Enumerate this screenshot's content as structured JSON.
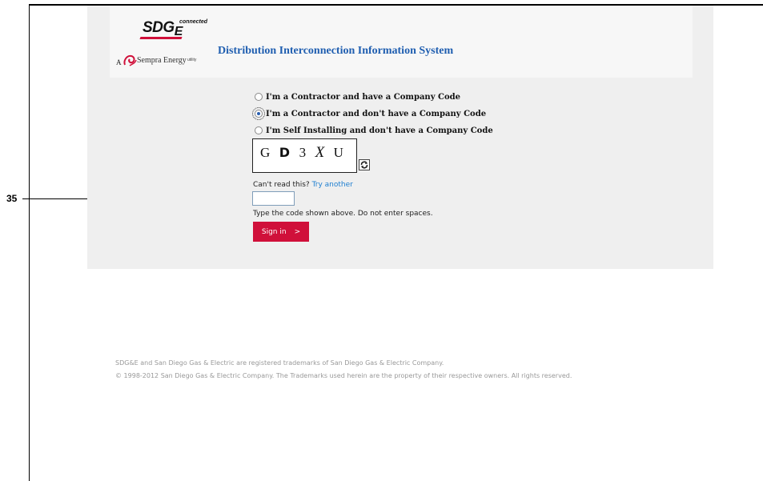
{
  "annotation": {
    "callout_number": "35"
  },
  "header": {
    "logo": {
      "brand": "SDG",
      "brand_e": "E",
      "tagline": "connected",
      "parent_prefix": "A",
      "parent_name": "Sempra Energy",
      "parent_suffix": "utility"
    },
    "title": "Distribution Interconnection Information System"
  },
  "form": {
    "options": [
      {
        "label": "I'm a Contractor and have a Company Code",
        "checked": false
      },
      {
        "label": "I'm a Contractor and don't have a Company Code",
        "checked": true
      },
      {
        "label": "I'm Self Installing and don't have a Company Code",
        "checked": false
      }
    ],
    "captcha": {
      "chars": [
        "G",
        "D",
        "3",
        "X",
        "U"
      ]
    },
    "refresh_icon": "refresh-icon",
    "cant_read": "Can't read this?",
    "try_another": "Try another",
    "code_input": {
      "value": "",
      "placeholder": ""
    },
    "hint": "Type the code shown above. Do not enter spaces.",
    "signin_label": "Sign in",
    "signin_arrow": ">"
  },
  "footer": {
    "line1": "SDG&E and San Diego Gas & Electric are registered trademarks of San Diego Gas & Electric Company.",
    "line2": "© 1998-2012 San Diego Gas & Electric Company. The Trademarks used herein are the property of their respective owners. All rights reserved."
  },
  "colors": {
    "accent": "#d0103a",
    "link": "#1f7fd0",
    "title": "#1f5eb0",
    "panel": "#efefef"
  }
}
